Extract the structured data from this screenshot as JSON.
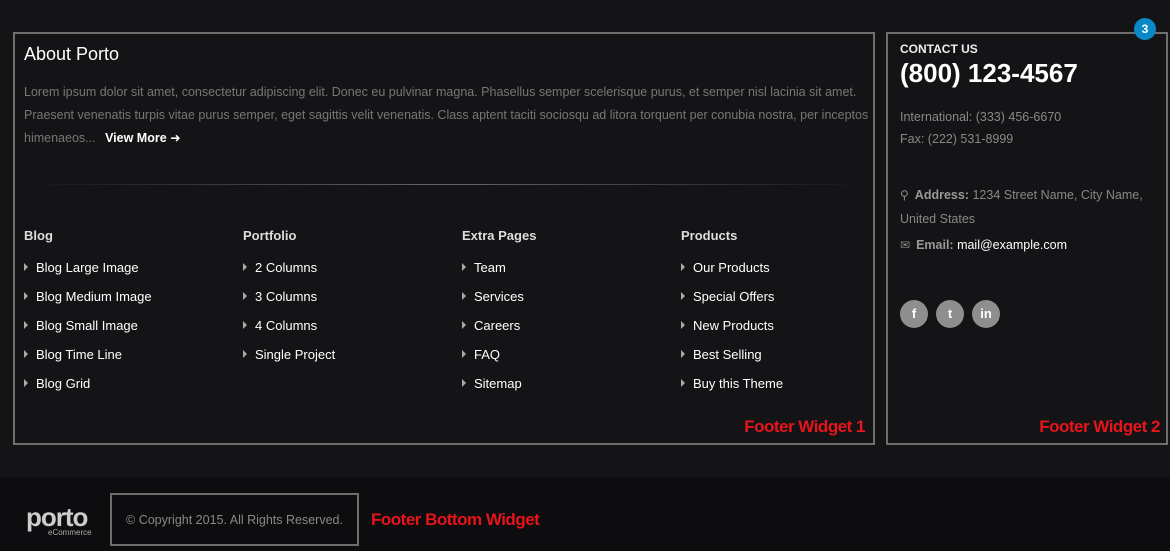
{
  "badge": "3",
  "about": {
    "title": "About Porto",
    "text": "Lorem ipsum dolor sit amet, consectetur adipiscing elit. Donec eu pulvinar magna. Phasellus semper scelerisque purus, et semper nisl lacinia sit amet. Praesent venenatis turpis vitae purus semper, eget sagittis velit venenatis. Class aptent taciti sociosqu ad litora torquent per conubia nostra, per inceptos himenaeos...",
    "view_more": "View More"
  },
  "columns": [
    {
      "title": "Blog",
      "items": [
        "Blog Large Image",
        "Blog Medium Image",
        "Blog Small Image",
        "Blog Time Line",
        "Blog Grid"
      ]
    },
    {
      "title": "Portfolio",
      "items": [
        "2 Columns",
        "3 Columns",
        "4 Columns",
        "Single Project"
      ]
    },
    {
      "title": "Extra Pages",
      "items": [
        "Team",
        "Services",
        "Careers",
        "FAQ",
        "Sitemap"
      ]
    },
    {
      "title": "Products",
      "items": [
        "Our Products",
        "Special Offers",
        "New Products",
        "Best Selling",
        "Buy this Theme"
      ]
    }
  ],
  "widget1_label": "Footer Widget 1",
  "widget2_label": "Footer Widget 2",
  "contact": {
    "heading": "CONTACT US",
    "phone": "(800) 123-4567",
    "international": "International: (333) 456-6670",
    "fax": "Fax: (222) 531-8999",
    "address_label": "Address:",
    "address_value": "1234 Street Name, City Name, United States",
    "email_label": "Email:",
    "email_value": "mail@example.com"
  },
  "socials": [
    {
      "icon": "facebook-icon",
      "glyph": "f"
    },
    {
      "icon": "twitter-icon",
      "glyph": "t"
    },
    {
      "icon": "linkedin-icon",
      "glyph": "in"
    }
  ],
  "bottom": {
    "logo_main": "porto",
    "logo_sub": "eCommerce",
    "copyright": "© Copyright 2015. All Rights Reserved.",
    "label": "Footer Bottom Widget"
  },
  "colors": {
    "accent_red": "#e8141b",
    "badge_blue": "#0a88c8"
  }
}
